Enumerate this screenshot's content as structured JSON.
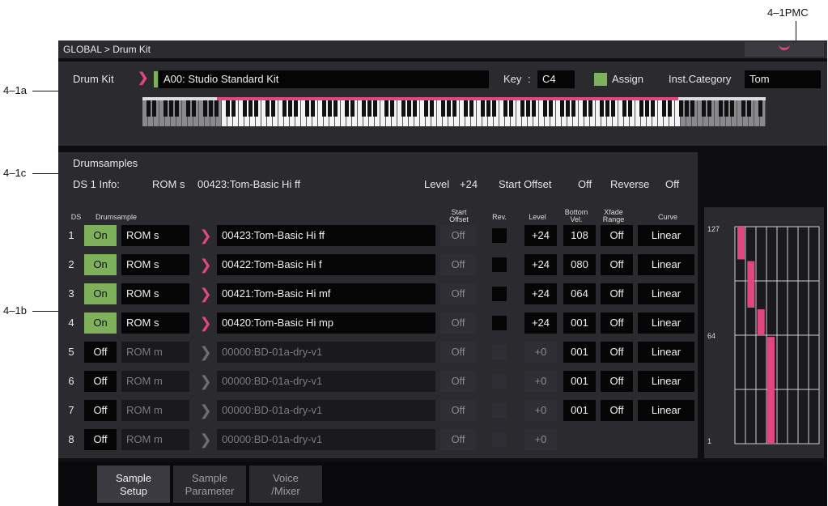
{
  "callouts": {
    "pmc": "4–1PMC",
    "a": "4–1a",
    "c": "4–1c",
    "b": "4–1b"
  },
  "titlebar": {
    "title": "GLOBAL > Drum Kit"
  },
  "kit": {
    "label": "Drum Kit",
    "name": "A00: Studio Standard Kit",
    "key_label": "Key",
    "key_sep": ":",
    "key_value": "C4",
    "assign_label": "Assign",
    "inst_category_label": "Inst.Category",
    "inst_category_value": "Tom"
  },
  "keyboard": {
    "mapped_range_fraction": [
      0.12,
      0.86
    ]
  },
  "drumsamples": {
    "title": "Drumsamples",
    "info_label": "DS 1 Info:",
    "info_bank": "ROM s",
    "info_sample": "00423:Tom-Basic Hi ff",
    "level_label": "Level",
    "level_value": "+24",
    "start_offset_label": "Start Offset",
    "start_offset_value": "Off",
    "reverse_label": "Reverse",
    "reverse_value": "Off"
  },
  "table": {
    "headers": {
      "ds": "DS",
      "drumsample": "Drumsample",
      "start_offset_1": "Start",
      "start_offset_2": "Offset",
      "rev": "Rev.",
      "level": "Level",
      "bottom_vel_1": "Bottom",
      "bottom_vel_2": "Vel.",
      "xfade_1": "Xfade",
      "xfade_2": "Range",
      "curve": "Curve"
    },
    "rows": [
      {
        "num": "1",
        "onoff": "On",
        "bank": "ROM s",
        "sample": "00423:Tom-Basic Hi ff",
        "start_offset": "Off",
        "level": "+24",
        "bottom_vel": "108",
        "xfade": "Off",
        "curve": "Linear"
      },
      {
        "num": "2",
        "onoff": "On",
        "bank": "ROM s",
        "sample": "00422:Tom-Basic Hi f",
        "start_offset": "Off",
        "level": "+24",
        "bottom_vel": "080",
        "xfade": "Off",
        "curve": "Linear"
      },
      {
        "num": "3",
        "onoff": "On",
        "bank": "ROM s",
        "sample": "00421:Tom-Basic Hi mf",
        "start_offset": "Off",
        "level": "+24",
        "bottom_vel": "064",
        "xfade": "Off",
        "curve": "Linear"
      },
      {
        "num": "4",
        "onoff": "On",
        "bank": "ROM s",
        "sample": "00420:Tom-Basic Hi mp",
        "start_offset": "Off",
        "level": "+24",
        "bottom_vel": "001",
        "xfade": "Off",
        "curve": "Linear"
      },
      {
        "num": "5",
        "onoff": "Off",
        "bank": "ROM m",
        "sample": "00000:BD-01a-dry-v1",
        "start_offset": "Off",
        "level": "+0",
        "bottom_vel": "001",
        "xfade": "Off",
        "curve": "Linear"
      },
      {
        "num": "6",
        "onoff": "Off",
        "bank": "ROM m",
        "sample": "00000:BD-01a-dry-v1",
        "start_offset": "Off",
        "level": "+0",
        "bottom_vel": "001",
        "xfade": "Off",
        "curve": "Linear"
      },
      {
        "num": "7",
        "onoff": "Off",
        "bank": "ROM m",
        "sample": "00000:BD-01a-dry-v1",
        "start_offset": "Off",
        "level": "+0",
        "bottom_vel": "001",
        "xfade": "Off",
        "curve": "Linear"
      },
      {
        "num": "8",
        "onoff": "Off",
        "bank": "ROM m",
        "sample": "00000:BD-01a-dry-v1",
        "start_offset": "Off",
        "level": "+0"
      }
    ]
  },
  "velocity_graph": {
    "label_top": "127",
    "label_mid": "64",
    "label_bottom": "1"
  },
  "tabs": [
    {
      "l1": "Sample",
      "l2": "Setup"
    },
    {
      "l1": "Sample",
      "l2": "Parameter"
    },
    {
      "l1": "Voice",
      "l2": "/Mixer"
    }
  ],
  "colors": {
    "accent": "#e0467f",
    "on_green": "#7fb05a",
    "panel": "#2b2b2f",
    "field": "#050505"
  }
}
